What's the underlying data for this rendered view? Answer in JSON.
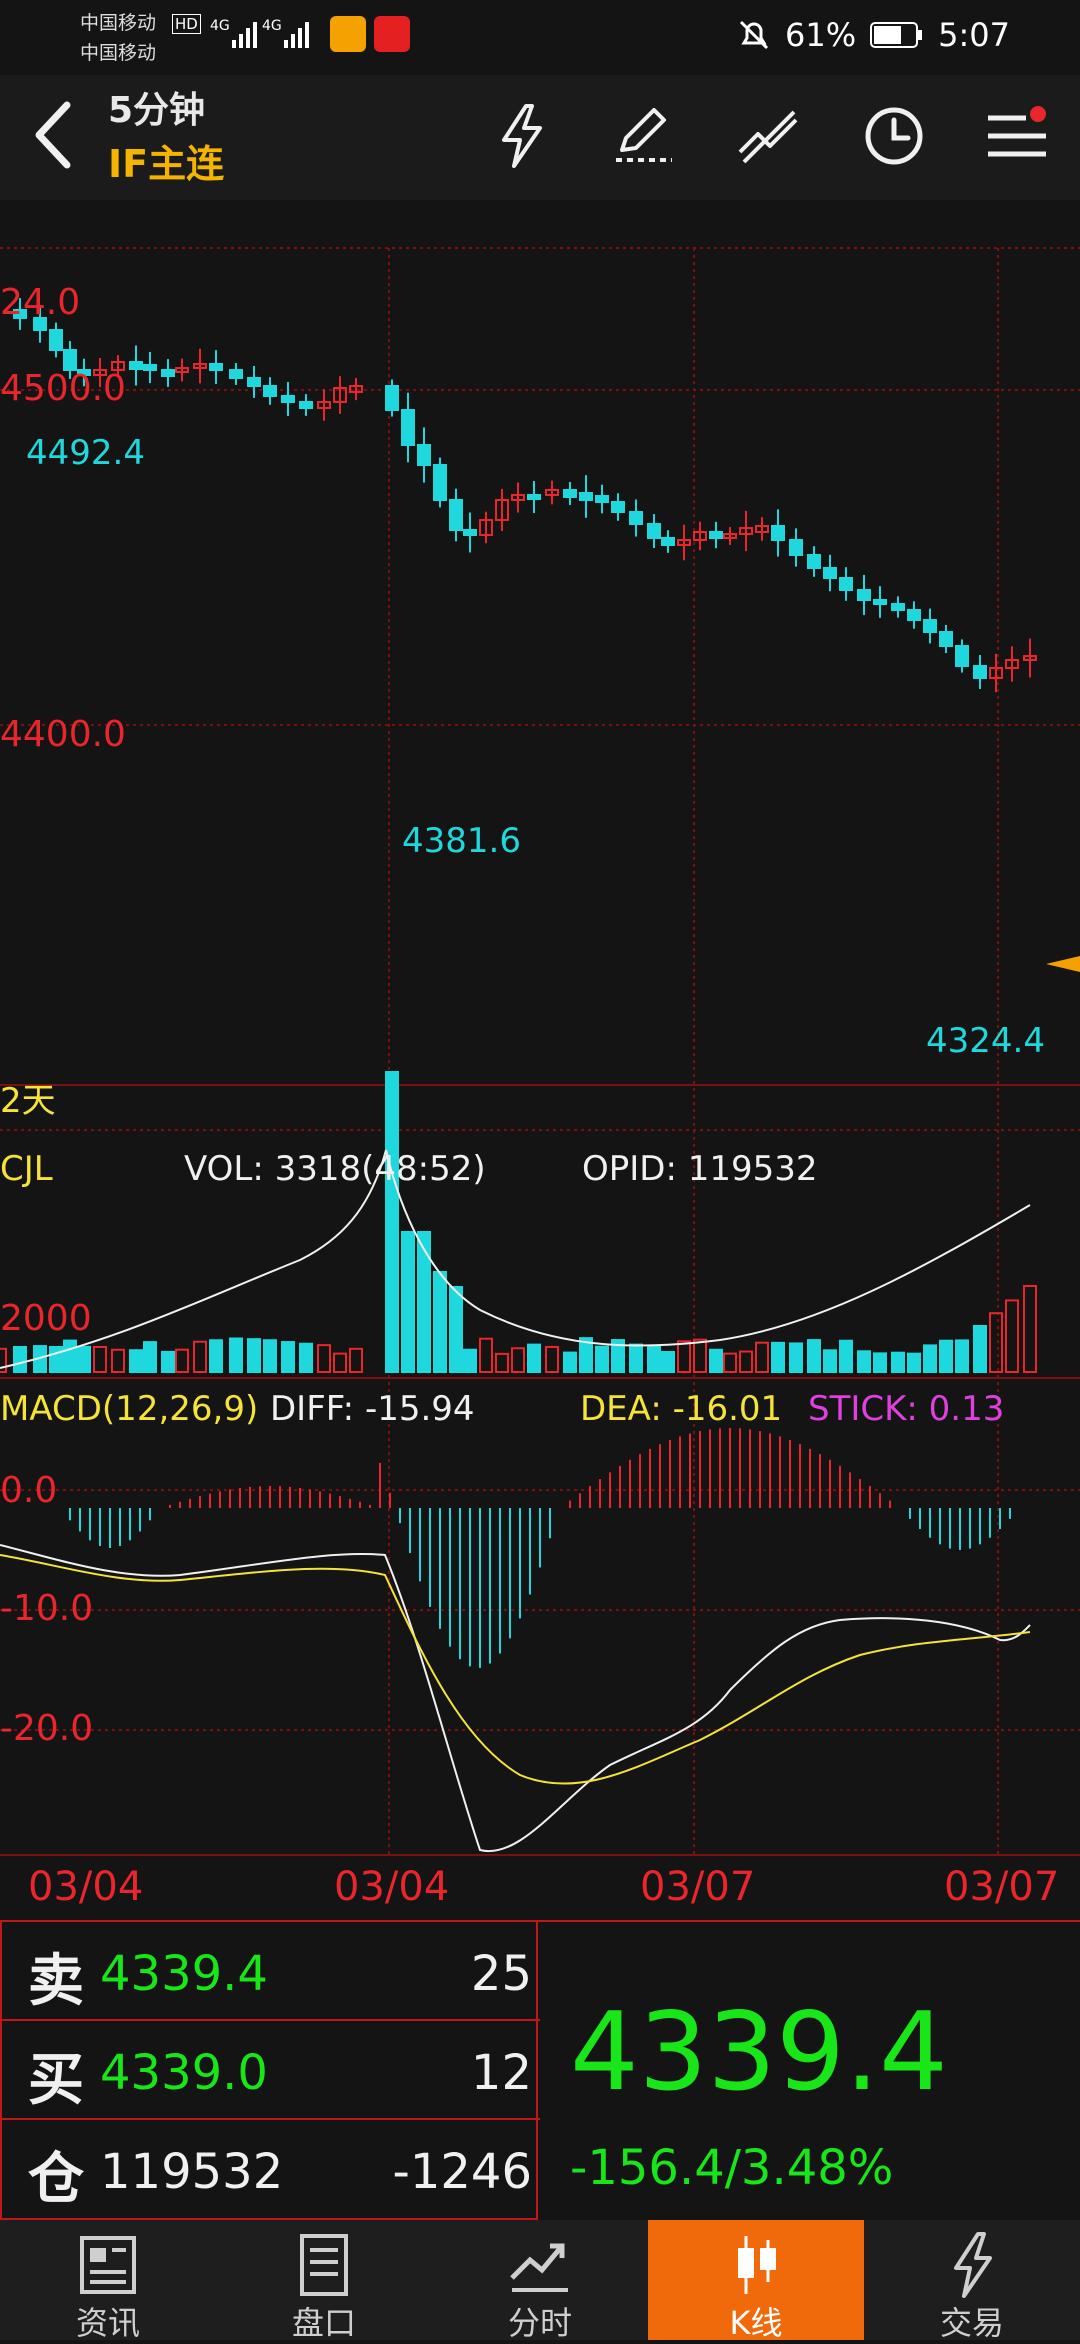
{
  "status": {
    "carrier1": "中国移动",
    "carrier2": "中国移动",
    "battery": "61%",
    "time": "5:07"
  },
  "header": {
    "period": "5分钟",
    "symbol": "IF主连"
  },
  "main_chart": {
    "price_labels": [
      "24.0",
      "4500.0",
      "4400.0"
    ],
    "high_low_marks": [
      "4492.4",
      "4381.6",
      "4324.4"
    ],
    "days_label": "2天"
  },
  "volume": {
    "name": "CJL",
    "vol": "VOL: 3318(48:52)",
    "opid": "OPID: 119532",
    "scale_label": "2000"
  },
  "macd": {
    "name": "MACD(12,26,9)",
    "diff": "DIFF: -15.94",
    "dea": "DEA: -16.01",
    "stick": "STICK: 0.13",
    "scale_labels": [
      "0.0",
      "-10.0",
      "-20.0"
    ]
  },
  "dates": [
    "03/04",
    "03/04",
    "03/07",
    "03/07"
  ],
  "quote": {
    "sell_label": "卖",
    "sell_price": "4339.4",
    "sell_qty": "25",
    "buy_label": "买",
    "buy_price": "4339.0",
    "buy_qty": "12",
    "oi_label": "仓",
    "oi_value": "119532",
    "oi_change": "-1246",
    "last_price": "4339.4",
    "change": "-156.4/3.48%"
  },
  "tabs": [
    {
      "label": "资讯",
      "icon": "news-icon"
    },
    {
      "label": "盘口",
      "icon": "orderbook-icon"
    },
    {
      "label": "分时",
      "icon": "timeshare-icon"
    },
    {
      "label": "K线",
      "icon": "kline-icon"
    },
    {
      "label": "交易",
      "icon": "trade-icon"
    }
  ],
  "colors": {
    "up": "#e8262b",
    "down": "#1fd8de",
    "grid": "#7a1010",
    "accent": "#f06a0c",
    "green": "#19e619",
    "yellow": "#f5e33a",
    "magenta": "#e040e0"
  }
}
